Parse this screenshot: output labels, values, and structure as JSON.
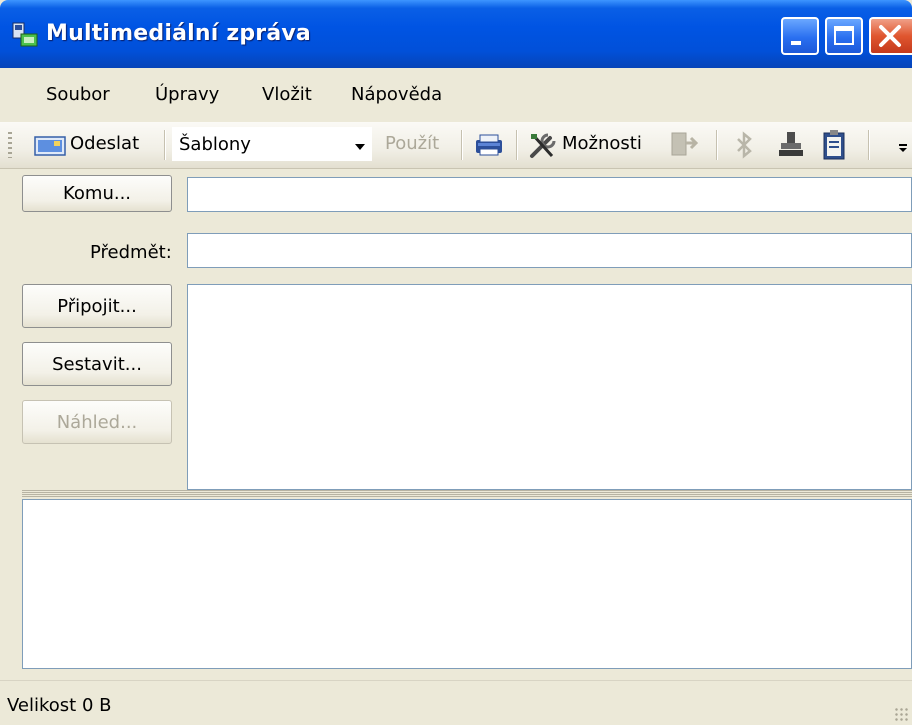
{
  "window": {
    "title": "Multimediální zpráva",
    "controls": {
      "minimize": "minimize",
      "maximize": "maximize",
      "close": "close"
    }
  },
  "menu": {
    "items": [
      "Soubor",
      "Úpravy",
      "Vložit",
      "Nápověda"
    ]
  },
  "toolbar": {
    "send_label": "Odeslat",
    "templates_value": "Šablony",
    "apply_label": "Použít",
    "options_label": "Možnosti",
    "icons": [
      "send-icon",
      "printer-icon",
      "tools-icon",
      "export-icon",
      "bluetooth-icon",
      "stamp-icon",
      "clipboard-icon"
    ]
  },
  "form": {
    "to_button": "Komu...",
    "to_value": "",
    "subject_label": "Předmět:",
    "subject_value": "",
    "attach_button": "Připojit...",
    "compose_button": "Sestavit...",
    "preview_button": "Náhled...",
    "body_value": "",
    "notes_value": ""
  },
  "status": {
    "size_text": "Velikost 0 B"
  },
  "colors": {
    "titlebar": "#0054e3",
    "face": "#ece9d8",
    "close_button": "#e0562f",
    "field_border": "#7f9db9"
  }
}
